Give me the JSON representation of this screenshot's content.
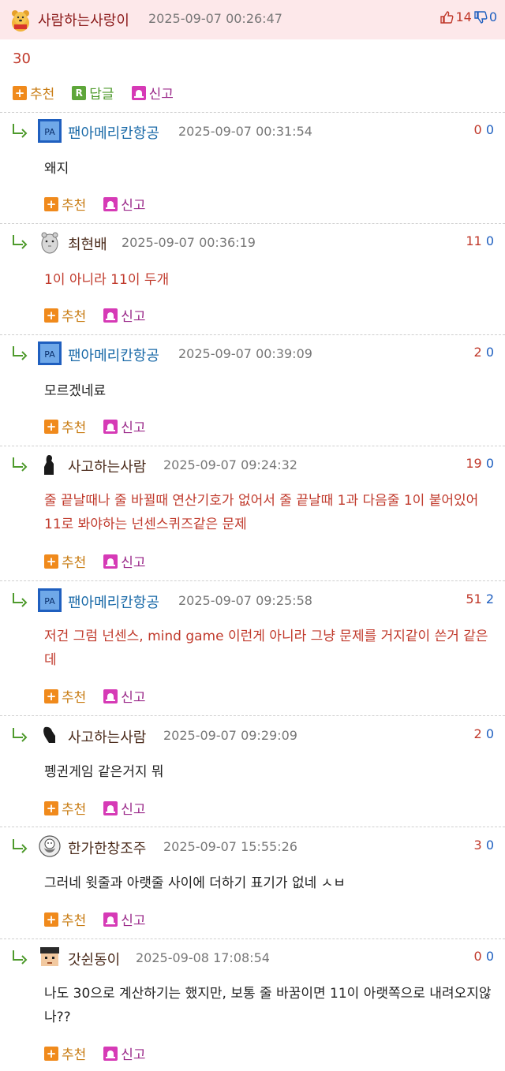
{
  "post": {
    "author": "사람하는사랑이",
    "date": "2025-09-07 00:26:47",
    "upvotes": "14",
    "downvotes": "0",
    "body": "30",
    "actions": {
      "recommend": "추천",
      "reply": "답글",
      "report": "신고"
    }
  },
  "comments": [
    {
      "author": "팬아메리칸항공",
      "date": "2025-09-07 00:31:54",
      "up": "0",
      "down": "0",
      "text": "왜지",
      "avatar": "pan-am-icon",
      "recommend": "추천",
      "report": "신고"
    },
    {
      "author": "최현배",
      "date": "2025-09-07 00:36:19",
      "up": "11",
      "down": "0",
      "text": "1이 아니라 11이 두개",
      "avatar": "hamster-icon",
      "recommend": "추천",
      "report": "신고"
    },
    {
      "author": "팬아메리칸항공",
      "date": "2025-09-07 00:39:09",
      "up": "2",
      "down": "0",
      "text": "모르겠네료",
      "avatar": "pan-am-icon",
      "recommend": "추천",
      "report": "신고"
    },
    {
      "author": "사고하는사람",
      "date": "2025-09-07 09:24:32",
      "up": "19",
      "down": "0",
      "text": "줄 끝날때나 줄 바뀔때 연산기호가 없어서 줄 끝날때 1과 다음줄 1이 붙어있어 11로 봐야하는 넌센스퀴즈같은 문제",
      "avatar": "thinker-statue-icon",
      "recommend": "추천",
      "report": "신고"
    },
    {
      "author": "팬아메리칸항공",
      "date": "2025-09-07 09:25:58",
      "up": "51",
      "down": "2",
      "text": "저건 그럼 넌센스, mind game 이런게 아니라 그냥 문제를 거지같이 쓴거 같은데",
      "avatar": "pan-am-icon",
      "recommend": "추천",
      "report": "신고"
    },
    {
      "author": "사고하는사람",
      "date": "2025-09-07 09:29:09",
      "up": "2",
      "down": "0",
      "text": "펭귄게임 같은거지 뭐",
      "avatar": "thinker-statue-icon",
      "recommend": "추천",
      "report": "신고"
    },
    {
      "author": "한가한창조주",
      "date": "2025-09-07 15:55:26",
      "up": "3",
      "down": "0",
      "text": "그러네 윗줄과 아랫줄 사이에 더하기 표기가 없네 ㅅㅂ",
      "avatar": "bearded-face-icon",
      "recommend": "추천",
      "report": "신고"
    },
    {
      "author": "갓쉰동이",
      "date": "2025-09-08 17:08:54",
      "up": "0",
      "down": "0",
      "text": "나도 30으로 계산하기는 했지만, 보통 줄 바꿈이면 11이 아랫쪽으로 내려오지않나??",
      "avatar": "pixel-face-icon",
      "recommend": "추천",
      "report": "신고"
    }
  ]
}
